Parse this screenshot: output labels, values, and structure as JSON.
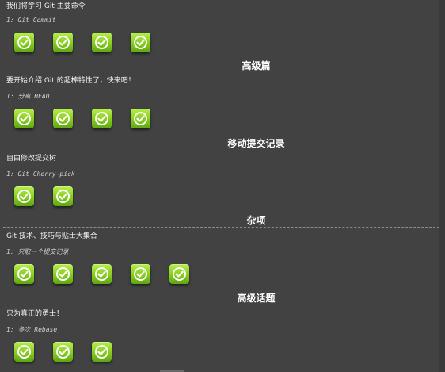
{
  "sections": [
    {
      "intro": "我们将学习 Git 主要命令",
      "level_label": "1: Git Commit",
      "badge_count": 4
    },
    {
      "title": "高级篇",
      "intro": "要开始介绍 Git 的超棒特性了，快来吧！",
      "level_label": "1: 分离 HEAD",
      "badge_count": 4
    },
    {
      "title": "移动提交记录",
      "intro": "自由修改提交树",
      "level_label": "1: Git Cherry-pick",
      "badge_count": 2
    },
    {
      "title": "杂项",
      "intro": "Git 技术、技巧与贴士大集合",
      "level_label": "1: 只取一个提交记录",
      "badge_count": 5
    },
    {
      "title": "高级话题",
      "intro": "只为真正的勇士！",
      "level_label": "1: 多次 Rebase",
      "badge_count": 3
    }
  ],
  "colors": {
    "badge": "#8bd024",
    "background": "#424242"
  },
  "icons": {
    "badge": "check-circle-icon"
  }
}
